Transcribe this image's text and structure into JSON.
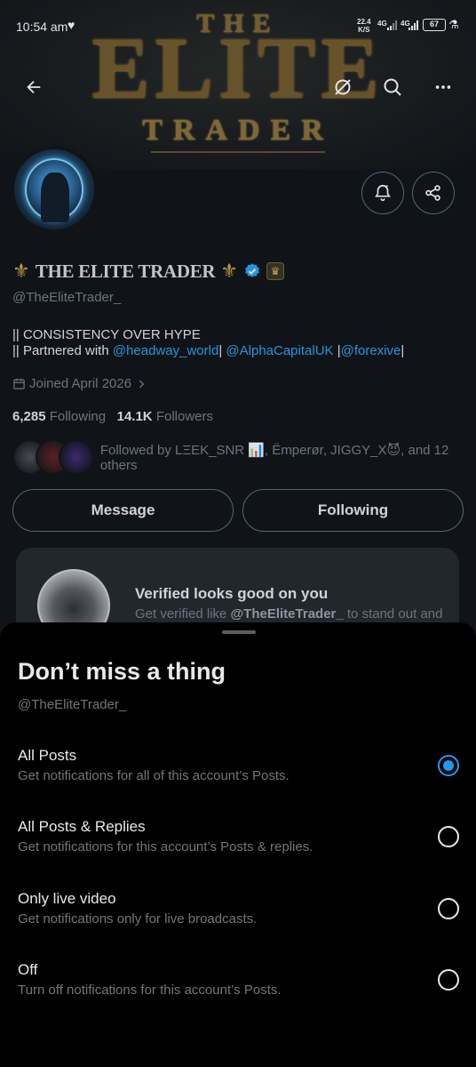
{
  "status_bar": {
    "time": "10:54 am",
    "speed_value": "22.4",
    "speed_unit": "K/S",
    "net1": "4G",
    "net2": "4G",
    "battery": "67"
  },
  "banner": {
    "line1": "THE",
    "line2": "ELITE",
    "line3": "TRADER"
  },
  "profile": {
    "display_name": "THE ELITE TRADER",
    "name_fleur": "⚜️",
    "handle": "@TheEliteTrader_",
    "bio_line1": "|| CONSISTENCY OVER HYPE",
    "bio_line2_prefix": "|| Partnered with ",
    "bio_link1": "@headway_world",
    "bio_sep1": "| ",
    "bio_link2": "@AlphaCapitalUK",
    "bio_sep2": " |",
    "bio_link3": "@forexive",
    "bio_sep3": "|",
    "joined": "Joined April 2026",
    "following_count": "6,285",
    "following_label": "Following",
    "followers_count": "14.1K",
    "followers_label": "Followers",
    "followed_by": "Followed by LΞEK_SNR 📊, Ëmperør, JIGGY_X😈, and 12 others"
  },
  "actions": {
    "message": "Message",
    "following": "Following"
  },
  "promo": {
    "title": "Verified looks good on you",
    "subtitle_prefix": "Get verified like ",
    "subtitle_handle": "@TheEliteTrader_",
    "subtitle_suffix": " to stand out and"
  },
  "sheet": {
    "title": "Don’t miss a thing",
    "handle": "@TheEliteTrader_",
    "options": [
      {
        "label": "All Posts",
        "desc": "Get notifications for all of this account’s Posts.",
        "selected": true
      },
      {
        "label": "All Posts & Replies",
        "desc": "Get notifications for this account’s Posts & replies.",
        "selected": false
      },
      {
        "label": "Only live video",
        "desc": "Get notifications only for live broadcasts.",
        "selected": false
      },
      {
        "label": "Off",
        "desc": "Turn off notifications for this account’s Posts.",
        "selected": false
      }
    ]
  },
  "colors": {
    "accent": "#1d9bf0",
    "muted": "#71767b",
    "text": "#e7e9ea",
    "gold": "#d4a437"
  }
}
